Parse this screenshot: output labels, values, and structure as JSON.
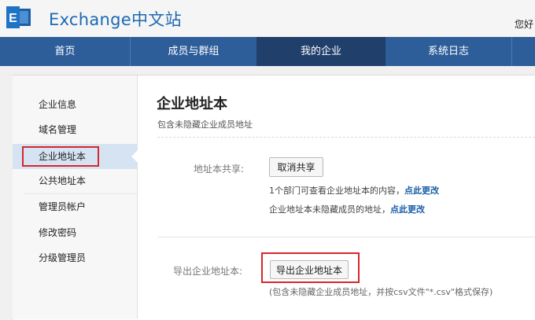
{
  "header": {
    "logo_mark": "E",
    "title": "Exchange中文站",
    "greeting": "您好"
  },
  "nav": {
    "items": [
      "首页",
      "成员与群组",
      "我的企业",
      "系统日志"
    ],
    "active_index": 2
  },
  "sidebar": {
    "items": [
      "企业信息",
      "域名管理",
      "企业地址本",
      "公共地址本",
      "管理员帐户",
      "修改密码",
      "分级管理员"
    ],
    "active_index": 2
  },
  "main": {
    "title": "企业地址本",
    "subtitle": "包含未隐藏企业成员地址",
    "share": {
      "label": "地址本共享:",
      "button": "取消共享",
      "note1_text": "1个部门可查看企业地址本的内容，",
      "note1_link": "点此更改",
      "note2_text": "企业地址本未隐藏成员的地址，",
      "note2_link": "点此更改"
    },
    "export": {
      "label": "导出企业地址本:",
      "button": "导出企业地址本",
      "note": "(包含未隐藏企业成员地址，并按csv文件\"*.csv\"格式保存)"
    }
  },
  "colors": {
    "nav_bg": "#2e5e9a",
    "nav_active": "#213f6b",
    "brand": "#1c69b3",
    "link": "#1c5fa8",
    "highlight_box": "#d7272b"
  }
}
